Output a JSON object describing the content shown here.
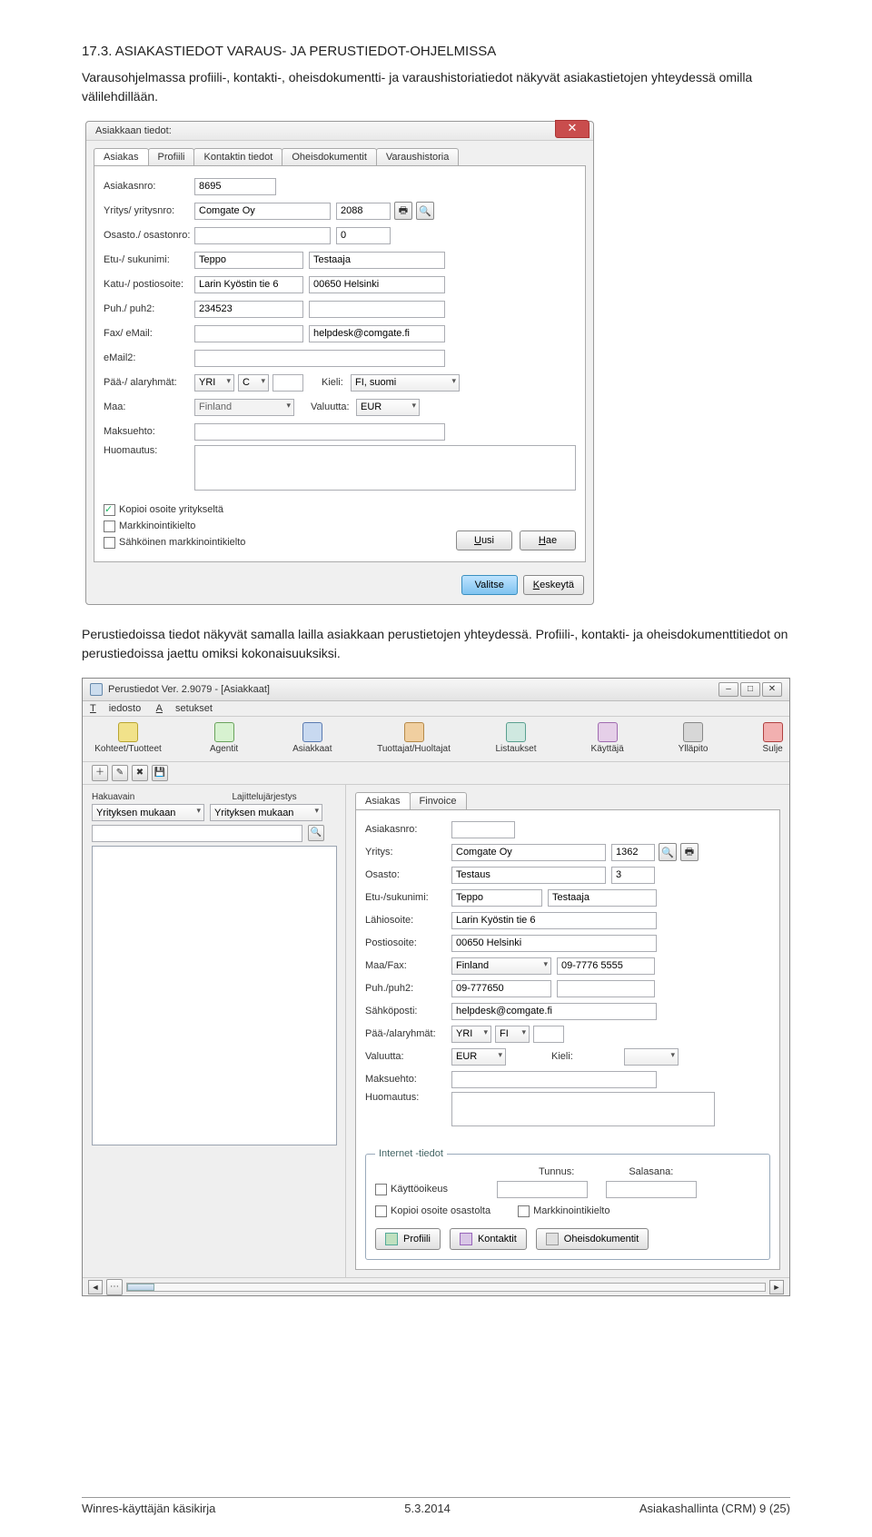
{
  "doc": {
    "heading": "17.3. ASIAKASTIEDOT VARAUS- JA PERUSTIEDOT-OHJELMISSA",
    "para1": "Varausohjelmassa profiili-, kontakti-, oheisdokumentti- ja varaushistoriatiedot näkyvät asiakastietojen yhteydessä omilla välilehdillään.",
    "para2": "Perustiedoissa tiedot näkyvät samalla lailla asiakkaan perustietojen yhteydessä. Profiili-, kontakti- ja oheisdokumenttitiedot on perustiedoissa jaettu omiksi kokonaisuuksiksi."
  },
  "footer": {
    "left": "Winres-käyttäjän käsikirja",
    "center": "5.3.2014",
    "right": "Asiakashallinta (CRM)  9 (25)"
  },
  "dialog1": {
    "title": "Asiakkaan tiedot:",
    "tabs": [
      "Asiakas",
      "Profiili",
      "Kontaktin tiedot",
      "Oheisdokumentit",
      "Varaushistoria"
    ],
    "fields": {
      "asiakasnro_lbl": "Asiakasnro:",
      "asiakasnro": "8695",
      "yritys_lbl": "Yritys/ yritysnro:",
      "yritys": "Comgate Oy",
      "yritysnro": "2088",
      "osasto_lbl": "Osasto./ osastonro:",
      "osasto": "",
      "osastonro": "0",
      "etusuku_lbl": "Etu-/ sukunimi:",
      "etu": "Teppo",
      "suku": "Testaaja",
      "katu_lbl": "Katu-/ postiosoite:",
      "katu": "Larin Kyöstin tie 6",
      "posti": "00650 Helsinki",
      "puh_lbl": "Puh./ puh2:",
      "puh": "234523",
      "puh2": "",
      "fax_lbl": "Fax/ eMail:",
      "fax": "",
      "email": "helpdesk@comgate.fi",
      "email2_lbl": "eMail2:",
      "email2": "",
      "ryhma_lbl": "Pää-/ alaryhmät:",
      "paaryhma": "YRI",
      "alaryhma": "C",
      "kieli_lbl": "Kieli:",
      "kieli": "FI, suomi",
      "maa_lbl": "Maa:",
      "maa": "Finland",
      "valuutta_lbl": "Valuutta:",
      "valuutta": "EUR",
      "maksuehto_lbl": "Maksuehto:",
      "huom_lbl": "Huomautus:"
    },
    "checks": {
      "kopioi": "Kopioi osoite yritykseltä",
      "mark": "Markkinointikielto",
      "sahk": "Sähköinen markkinointikielto"
    },
    "buttons": {
      "uusi": "Uusi",
      "hae": "Hae",
      "valitse": "Valitse",
      "keskeyta": "Keskeytä"
    }
  },
  "win2": {
    "title": "Perustiedot Ver. 2.9079 - [Asiakkaat]",
    "menubar": [
      "Tiedosto",
      "Asetukset"
    ],
    "toolbar": [
      "Kohteet/Tuotteet",
      "Agentit",
      "Asiakkaat",
      "Tuottajat/Huoltajat",
      "Listaukset",
      "Käyttäjä",
      "Ylläpito",
      "Sulje"
    ],
    "left": {
      "hdr1": "Hakuavain",
      "hdr2": "Lajittelujärjestys",
      "sel1": "Yrityksen mukaan",
      "sel2": "Yrityksen mukaan"
    },
    "tabs": [
      "Asiakas",
      "Finvoice"
    ],
    "form": {
      "asiakasnro_lbl": "Asiakasnro:",
      "asiakasnro": "",
      "yritys_lbl": "Yritys:",
      "yritys": "Comgate Oy",
      "yritysnro": "1362",
      "osasto_lbl": "Osasto:",
      "osasto": "Testaus",
      "osastonro": "3",
      "etusuku_lbl": "Etu-/sukunimi:",
      "etu": "Teppo",
      "suku": "Testaaja",
      "lahi_lbl": "Lähiosoite:",
      "lahi": "Larin Kyöstin tie 6",
      "postios_lbl": "Postiosoite:",
      "postios": "00650 Helsinki",
      "maafax_lbl": "Maa/Fax:",
      "maa": "Finland",
      "fax": "09-7776 5555",
      "puh_lbl": "Puh./puh2:",
      "puh": "09-777650",
      "puh2": "",
      "sposti_lbl": "Sähköposti:",
      "sposti": "helpdesk@comgate.fi",
      "ryhma_lbl": "Pää-/alaryhmät:",
      "paaryhma": "YRI",
      "ala": "FI",
      "valuutta_lbl": "Valuutta:",
      "valuutta": "EUR",
      "kieli_lbl": "Kieli:",
      "kieli": "",
      "maksuehto_lbl": "Maksuehto:",
      "huom_lbl": "Huomautus:"
    },
    "internet": {
      "legend": "Internet -tiedot",
      "tunnus_lbl": "Tunnus:",
      "salasana_lbl": "Salasana:",
      "kaytto": "Käyttöoikeus",
      "kopioi": "Kopioi osoite osastolta",
      "mark": "Markkinointikielto"
    },
    "buttons": {
      "profiili": "Profiili",
      "kontaktit": "Kontaktit",
      "oheis": "Oheisdokumentit"
    }
  }
}
